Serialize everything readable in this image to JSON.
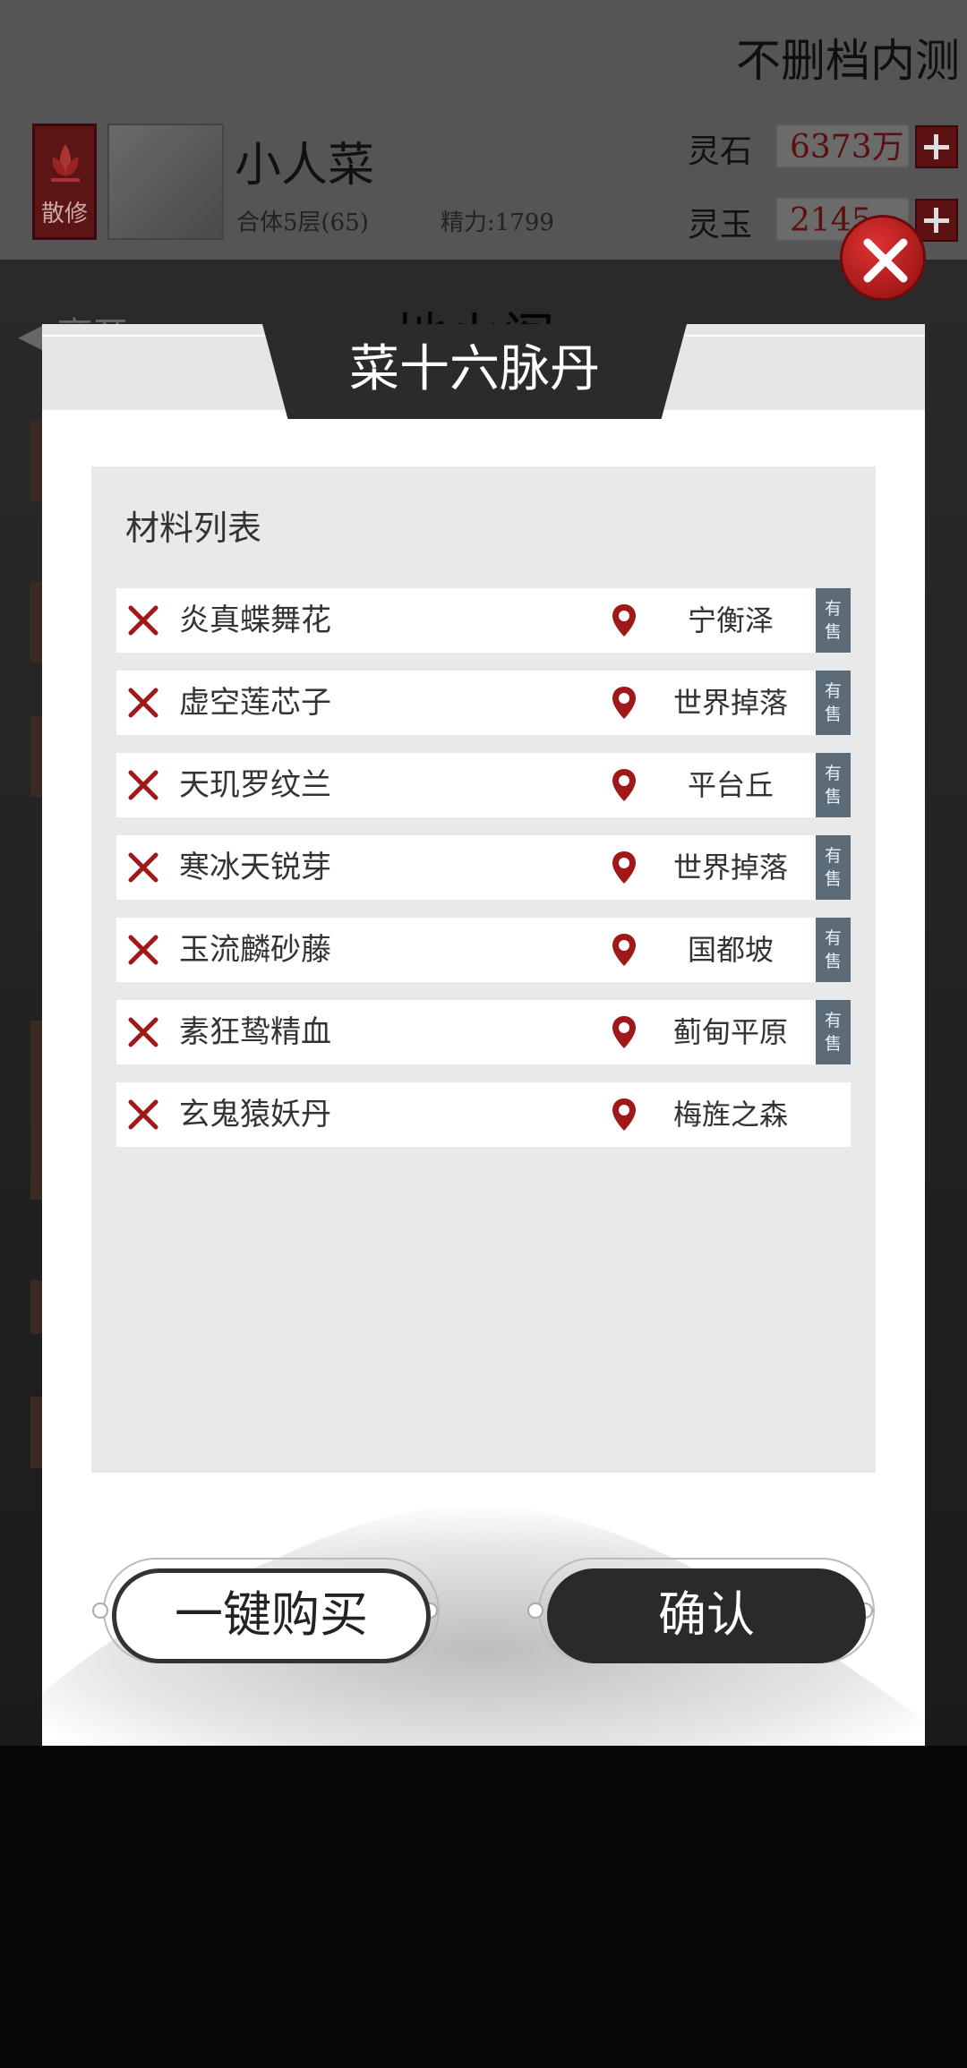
{
  "header": {
    "server_note": "不删档内测",
    "sect_badge": "散修",
    "player_name": "小人菜",
    "level": "合体5层(65)",
    "energy": "精力:1799",
    "currencies": [
      {
        "label": "灵石",
        "value": "6373万"
      },
      {
        "label": "灵玉",
        "value": "2145"
      }
    ]
  },
  "background": {
    "nav_title": "地火阁",
    "back_label": "离开"
  },
  "dialog": {
    "title": "菜十六脉丹",
    "materials_heading": "材料列表",
    "materials": [
      {
        "name": "炎真蝶舞花",
        "location": "宁衡泽",
        "sale": "有售"
      },
      {
        "name": "虚空莲芯子",
        "location": "世界掉落",
        "sale": "有售"
      },
      {
        "name": "天玑罗纹兰",
        "location": "平台丘",
        "sale": "有售"
      },
      {
        "name": "寒冰天锐芽",
        "location": "世界掉落",
        "sale": "有售"
      },
      {
        "name": "玉流麟砂藤",
        "location": "国都坡",
        "sale": "有售"
      },
      {
        "name": "素狂鸷精血",
        "location": "蓟甸平原",
        "sale": "有售"
      },
      {
        "name": "玄鬼猿妖丹",
        "location": "梅旌之森",
        "sale": ""
      }
    ],
    "buy_all_label": "一键购买",
    "confirm_label": "确认"
  },
  "colors": {
    "accent_red": "#8f0d0d",
    "sale_tag": "#5b6b77",
    "title_bar": "#2b2b2b"
  }
}
